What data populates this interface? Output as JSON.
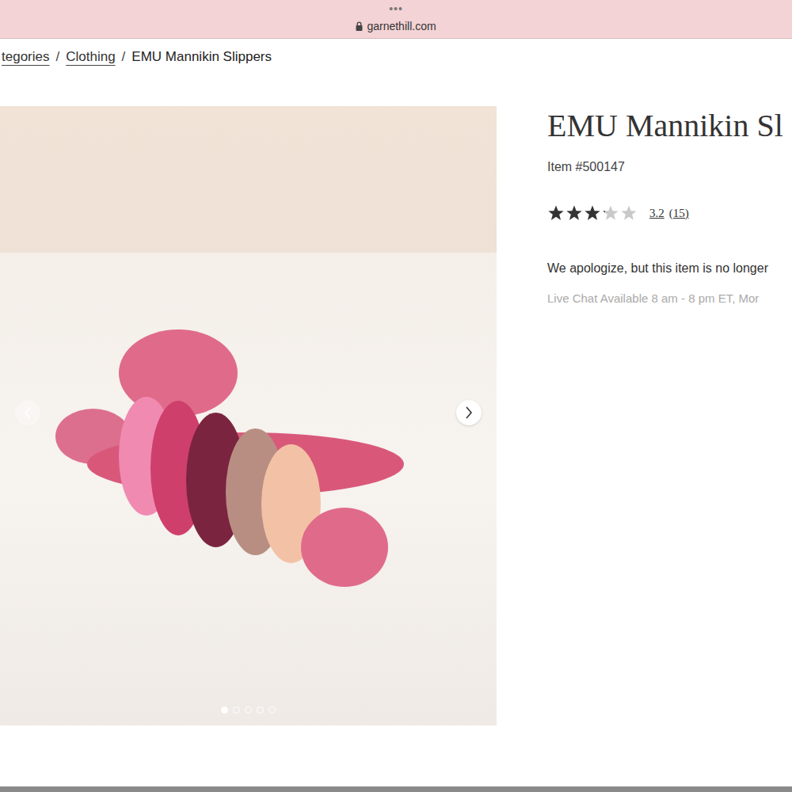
{
  "browser": {
    "menu": "•••",
    "address": "garnethill.com"
  },
  "breadcrumb": [
    {
      "label": "tegories",
      "link": true
    },
    {
      "label": "Clothing",
      "link": true
    },
    {
      "label": "EMU Mannikin Slippers",
      "link": false
    }
  ],
  "breadcrumb_separator": "/",
  "gallery": {
    "dots": [
      {
        "selected": true
      },
      {
        "selected": false
      },
      {
        "selected": false
      },
      {
        "selected": false
      },
      {
        "selected": false
      }
    ]
  },
  "product": {
    "title": "EMU Mannikin Sl",
    "item": "Item #500147",
    "rating": {
      "stars": 3.2,
      "score": "3.2",
      "count": "(15)"
    },
    "notice": "We apologize, but this item is no longer",
    "chat": "Live Chat Available 8 am - 8 pm ET, Mor"
  }
}
